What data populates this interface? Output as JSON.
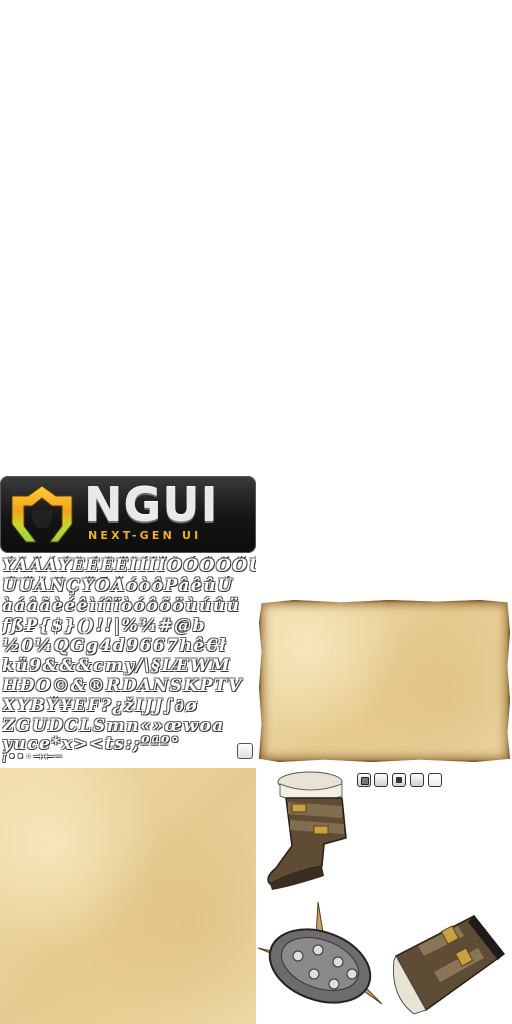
{
  "logo": {
    "title": "NGUI",
    "subtitle": "NEXT-GEN UI",
    "colors": {
      "mark_top": "#f2a21a",
      "mark_bottom": "#8fd63a",
      "subtitle": "#f0b21a"
    }
  },
  "atlas": {
    "glyph_rows": [
      "ÝÂÄÁÝÈÉÊËÌÍÎÏÒÓÔÕÖÙÚ",
      "ÛÜÅÑÇŸŌÄóòôPâêûÚ",
      "àáâãèéêìíîïòóôõöùúûü",
      "fß₽{$}()!!|%¾#@b",
      "½0¼QGg4d9667hê€ł",
      "kü9&&&cтy/\\§IÆWM",
      "HÐO©&®RDANSKPTV",
      "XYBŸ¥EF?¿žIJJ∫∂ø",
      "ZGUDCLSmn«»œwoa",
      "yuce*x><ts:;ºªº°",
      "¡••◦→←─"
    ]
  },
  "buttons": {
    "count": 5,
    "states": [
      "pressed",
      "normal",
      "dark",
      "normal",
      "light"
    ]
  },
  "sprites": {
    "items": [
      "boot-icon",
      "spiked-shield-icon",
      "bracer-icon"
    ]
  }
}
